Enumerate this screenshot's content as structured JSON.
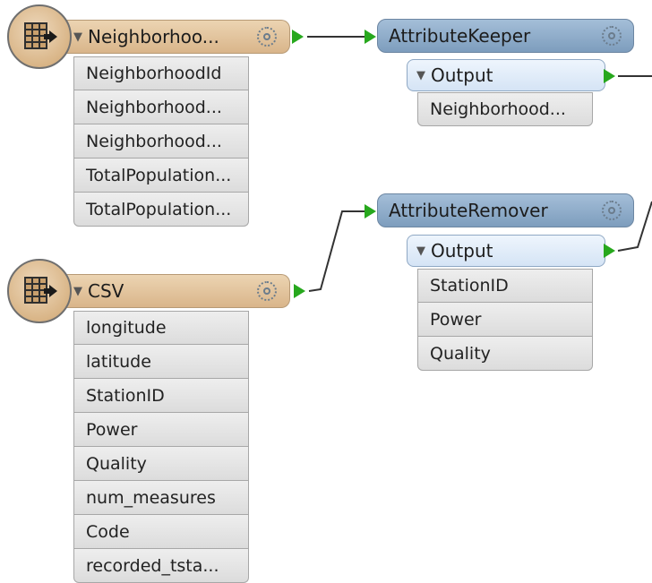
{
  "readers": [
    {
      "name": "Neighborhoo...",
      "attributes": [
        "NeighborhoodId",
        "Neighborhood...",
        "Neighborhood...",
        "TotalPopulation...",
        "TotalPopulation..."
      ]
    },
    {
      "name": "CSV",
      "attributes": [
        "longitude",
        "latitude",
        "StationID",
        "Power",
        "Quality",
        "num_measures",
        "Code",
        "recorded_tsta..."
      ]
    }
  ],
  "transformers": [
    {
      "name": "AttributeKeeper",
      "port": "Output",
      "attributes": [
        "Neighborhood..."
      ]
    },
    {
      "name": "AttributeRemover",
      "port": "Output",
      "attributes": [
        "StationID",
        "Power",
        "Quality"
      ]
    }
  ],
  "colors": {
    "reader_header": "#d9b58a",
    "transformer_header": "#7d9dbd",
    "port_green": "#27a81d",
    "connection": "#333333"
  },
  "icons": [
    "table-reader-icon",
    "gear-icon",
    "collapse-triangle-icon",
    "output-port-icon",
    "input-port-icon"
  ]
}
